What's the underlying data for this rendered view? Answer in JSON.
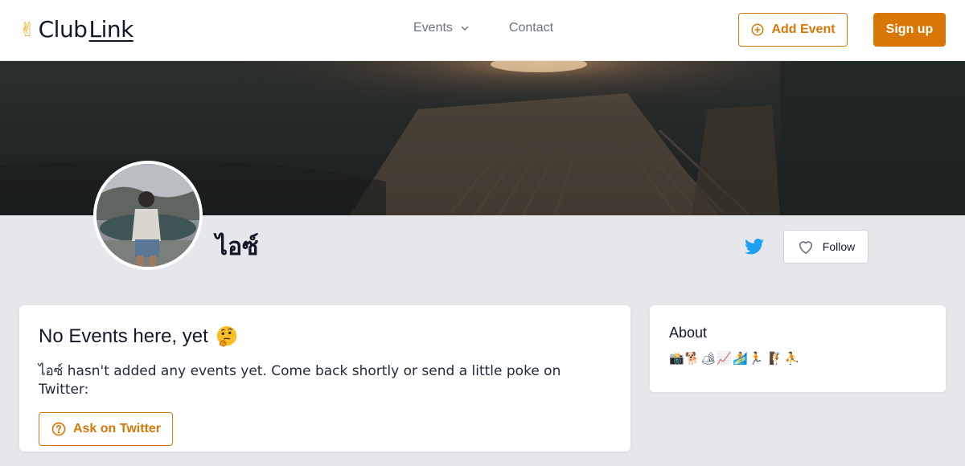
{
  "brand": {
    "logo_prefix": "Club",
    "logo_suffix": "Link",
    "logo_mark": "✌"
  },
  "nav": {
    "events_label": "Events",
    "contact_label": "Contact"
  },
  "actions": {
    "add_event_label": "Add Event",
    "signup_label": "Sign up"
  },
  "profile": {
    "name": "ไอซ์",
    "follow_label": "Follow"
  },
  "events": {
    "title": "No Events here, yet",
    "description": "ไอซ์ hasn't added any events yet. Come back shortly or send a little poke on Twitter:",
    "ask_label": "Ask on Twitter"
  },
  "about": {
    "title": "About",
    "text": "📸🐕🏕📈🏄🏃 🧗⛹"
  },
  "colors": {
    "accent": "#d97706",
    "twitter": "#1da1f2",
    "background": "#e5e7eb"
  },
  "icons": [
    "chevron-down-icon",
    "plus-circle-icon",
    "twitter-icon",
    "heart-icon",
    "thinking-face-icon",
    "question-circle-icon"
  ]
}
